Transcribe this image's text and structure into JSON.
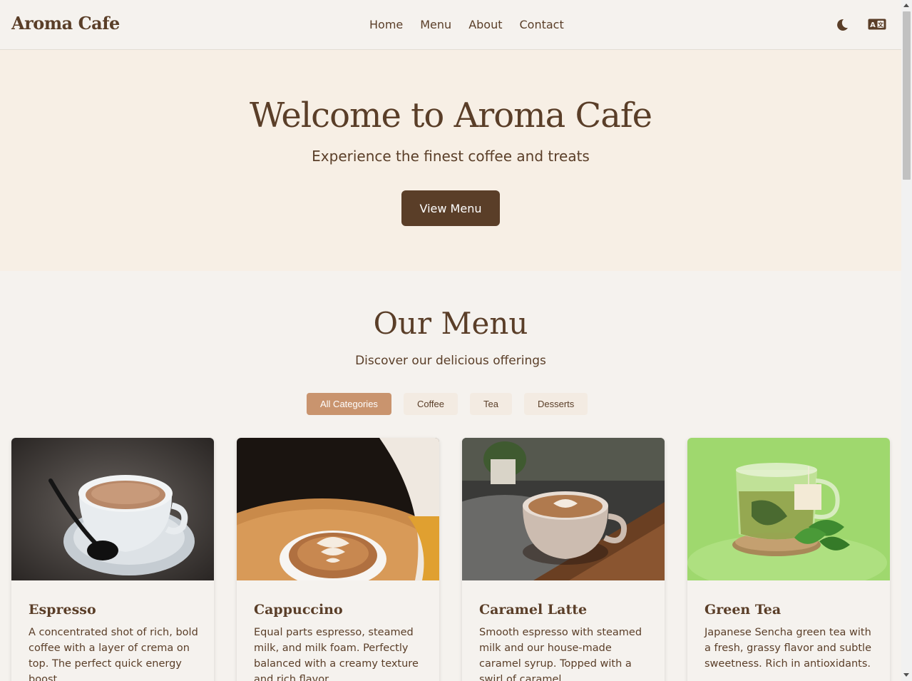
{
  "brand": "Aroma Cafe",
  "nav": {
    "home": "Home",
    "menu": "Menu",
    "about": "About",
    "contact": "Contact"
  },
  "icons": {
    "theme": "moon-icon",
    "language": "translate-icon"
  },
  "hero": {
    "title": "Welcome to Aroma Cafe",
    "subtitle": "Experience the finest coffee and treats",
    "button": "View Menu"
  },
  "menu": {
    "title": "Our Menu",
    "subtitle": "Discover our delicious offerings",
    "filters": [
      "All Categories",
      "Coffee",
      "Tea",
      "Desserts"
    ],
    "active_filter": "All Categories",
    "items": [
      {
        "name": "Espresso",
        "description": "A concentrated shot of rich, bold coffee with a layer of crema on top. The perfect quick energy boost."
      },
      {
        "name": "Cappuccino",
        "description": "Equal parts espresso, steamed milk, and milk foam. Perfectly balanced with a creamy texture and rich flavor."
      },
      {
        "name": "Caramel Latte",
        "description": "Smooth espresso with steamed milk and our house-made caramel syrup. Topped with a swirl of caramel."
      },
      {
        "name": "Green Tea",
        "description": "Japanese Sencha green tea with a fresh, grassy flavor and subtle sweetness. Rich in antioxidants."
      }
    ]
  },
  "colors": {
    "primary": "#5a3e28",
    "accent": "#c9946e",
    "hero_bg": "#f7efe5",
    "page_bg": "#f5f2ee"
  }
}
